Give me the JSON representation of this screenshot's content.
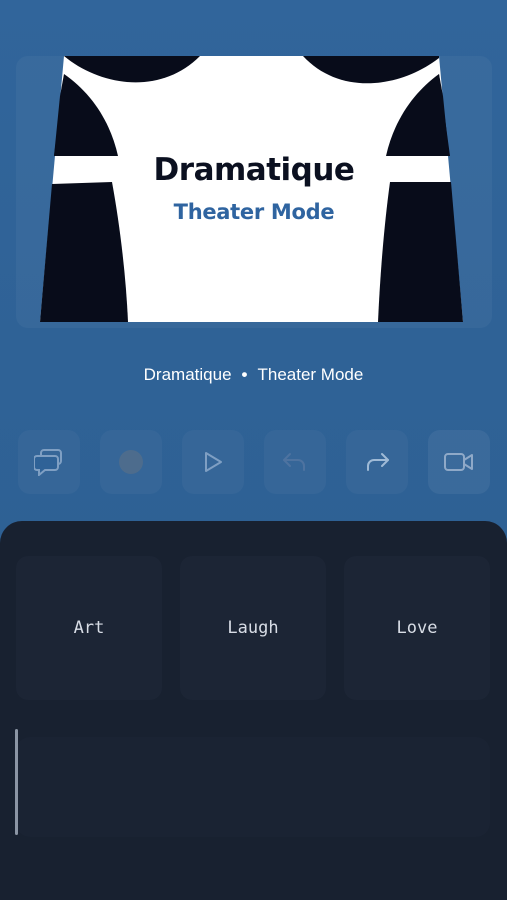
{
  "hero": {
    "title": "Dramatique",
    "subtitle": "Theater Mode"
  },
  "track": {
    "title": "Dramatique",
    "separator": "•",
    "mode": "Theater Mode"
  },
  "controls": [
    {
      "icon": "chat-bubbles-icon",
      "enabled": true
    },
    {
      "icon": "record-icon",
      "enabled": false
    },
    {
      "icon": "play-icon",
      "enabled": true
    },
    {
      "icon": "undo-icon",
      "enabled": false
    },
    {
      "icon": "redo-icon",
      "enabled": true
    },
    {
      "icon": "video-camera-icon",
      "enabled": true
    }
  ],
  "reactions": [
    "Art",
    "Laugh",
    "Love"
  ],
  "colors": {
    "background": "#2f6297",
    "panel": "#182130",
    "tile": "#1c2535",
    "accent": "#2f64a0"
  }
}
